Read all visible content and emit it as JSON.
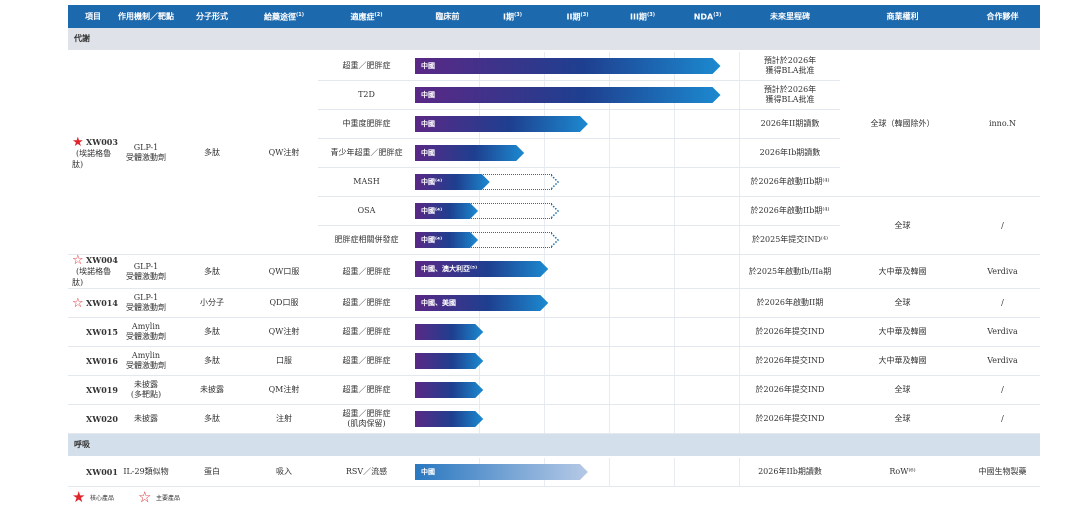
{
  "headers": [
    "項目",
    "作用機制／靶點",
    "分子形式",
    "給藥途徑",
    "適應症",
    "臨床前",
    "I期",
    "II期",
    "III期",
    "NDA",
    "未來里程碑",
    "商業權利",
    "合作夥伴"
  ],
  "header_sups": [
    "",
    "",
    "",
    "(1)",
    "(2)",
    "",
    "(3)",
    "(3)",
    "(3)",
    "(3)",
    "",
    "",
    ""
  ],
  "sections": [
    {
      "name": "代謝",
      "rows": [
        {
          "project": "XW003",
          "project_sub": "(埃諾格魯肽)",
          "star": "filled",
          "mechanism": "GLP-1\n受體激動劑",
          "form": "多肽",
          "route": "QW注射",
          "span": 7,
          "indications": [
            {
              "indication": "超重／肥胖症",
              "region": "中國",
              "progress": 4.7,
              "milestone": "預計於2026年\n獲得BLA批准"
            },
            {
              "indication": "T2D",
              "region": "中國",
              "progress": 4.7,
              "milestone": "預計於2026年\n獲得BLA批准"
            },
            {
              "indication": "中重度肥胖症",
              "region": "中國",
              "progress": 2.66,
              "milestone": "2026年II期讀數"
            },
            {
              "indication": "青少年超重／肥胖症",
              "region": "中國",
              "progress": 1.68,
              "milestone": "2026年Ib期讀數"
            },
            {
              "indication": "MASH",
              "region": "中國⁽⁴⁾",
              "progress": 1.15,
              "planned": 2.2,
              "milestone": "於2026年啟動IIb期⁽⁴⁾"
            },
            {
              "indication": "OSA",
              "region": "中國⁽⁴⁾",
              "progress": 0.97,
              "planned": 2.2,
              "milestone": "於2026年啟動IIb期⁽⁴⁾"
            },
            {
              "indication": "肥胖症相關併發症",
              "region": "中國⁽⁴⁾",
              "progress": 0.97,
              "planned": 2.2,
              "milestone": "於2025年提交IND⁽⁴⁾"
            }
          ],
          "rights": [
            {
              "text": "全球（韓國除外）",
              "partner": "inno.N",
              "span": 5
            },
            {
              "text": "全球",
              "partner": "/",
              "span": 2
            }
          ]
        },
        {
          "project": "XW004",
          "project_sub": "(埃諾格魯肽)",
          "star": "outline",
          "mechanism": "GLP-1\n受體激動劑",
          "form": "多肽",
          "route": "QW口服",
          "indications": [
            {
              "indication": "超重／肥胖症",
              "region": "中國、澳大利亞⁽⁵⁾",
              "progress": 2.05,
              "milestone": "於2025年啟動Ib/IIa期"
            }
          ],
          "rights": [
            {
              "text": "大中華及韓國",
              "partner": "Verdiva",
              "span": 1
            }
          ]
        },
        {
          "project": "XW014",
          "star": "outline",
          "mechanism": "GLP-1\n受體激動劑",
          "form": "小分子",
          "route": "QD口服",
          "indications": [
            {
              "indication": "超重／肥胖症",
              "region": "中國、美國",
              "progress": 2.05,
              "milestone": "於2026年啟動II期"
            }
          ],
          "rights": [
            {
              "text": "全球",
              "partner": "/",
              "span": 1
            }
          ]
        },
        {
          "project": "XW015",
          "mechanism": "Amylin\n受體激動劑",
          "form": "多肽",
          "route": "QW注射",
          "indications": [
            {
              "indication": "超重／肥胖症",
              "region": "",
              "progress": 1.05,
              "milestone": "於2026年提交IND"
            }
          ],
          "rights": [
            {
              "text": "大中華及韓國",
              "partner": "Verdiva",
              "span": 1
            }
          ]
        },
        {
          "project": "XW016",
          "mechanism": "Amylin\n受體激動劑",
          "form": "多肽",
          "route": "口服",
          "indications": [
            {
              "indication": "超重／肥胖症",
              "region": "",
              "progress": 1.05,
              "milestone": "於2026年提交IND"
            }
          ],
          "rights": [
            {
              "text": "大中華及韓國",
              "partner": "Verdiva",
              "span": 1
            }
          ]
        },
        {
          "project": "XW019",
          "mechanism": "未披露\n(多靶點)",
          "form": "未披露",
          "route": "QM注射",
          "indications": [
            {
              "indication": "超重／肥胖症",
              "region": "",
              "progress": 1.05,
              "milestone": "於2026年提交IND"
            }
          ],
          "rights": [
            {
              "text": "全球",
              "partner": "/",
              "span": 1
            }
          ]
        },
        {
          "project": "XW020",
          "mechanism": "未披露",
          "form": "多肽",
          "route": "注射",
          "indications": [
            {
              "indication": "超重／肥胖症\n(肌肉保留)",
              "region": "",
              "progress": 1.05,
              "milestone": "於2026年提交IND"
            }
          ],
          "rights": [
            {
              "text": "全球",
              "partner": "/",
              "span": 1
            }
          ]
        }
      ]
    },
    {
      "name": "呼吸",
      "rows": [
        {
          "project": "XW001",
          "mechanism": "IL-29類似物",
          "form": "蛋白",
          "route": "吸入",
          "light": true,
          "indications": [
            {
              "indication": "RSV／流感",
              "region": "中國",
              "progress": 2.66,
              "milestone": "2026年IIb期讀數"
            }
          ],
          "rights": [
            {
              "text": "RoW⁽⁶⁾",
              "partner": "中國生物製藥",
              "span": 1
            }
          ]
        }
      ]
    }
  ],
  "legend": [
    {
      "icon": "filled",
      "label": "核心產品"
    },
    {
      "icon": "outline",
      "label": "主要產品"
    }
  ],
  "colors": {
    "header": "#1d69ae",
    "star": "#e0242b",
    "bar_start": "#5a2886",
    "bar_end": "#1c8ad0"
  }
}
